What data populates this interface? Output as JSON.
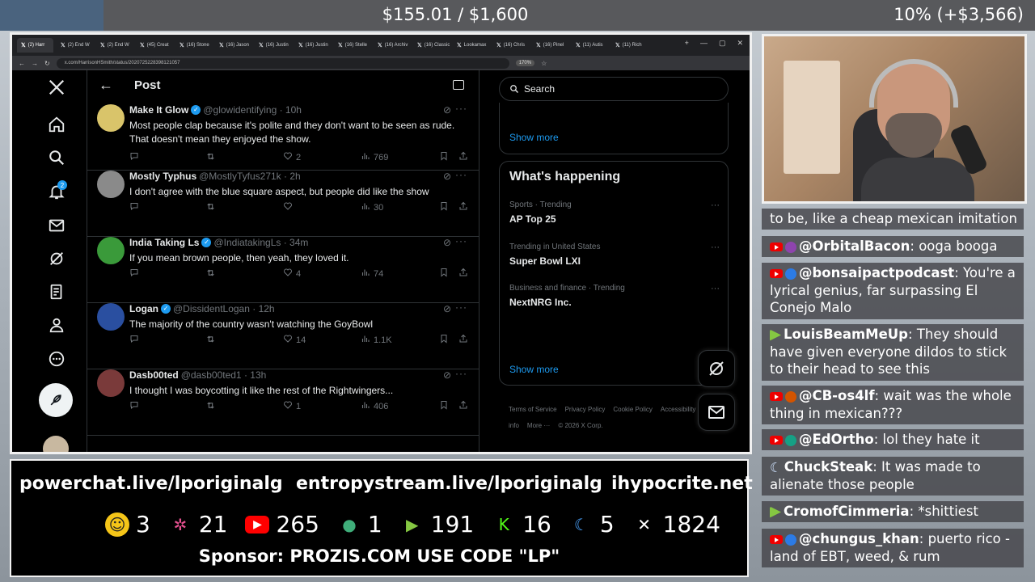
{
  "overlay": {
    "goal_text": "$155.01 / $1,600",
    "goal_percent_text": "10% (+$3,566)",
    "banner_links": [
      "powerchat.live/lporiginalg",
      "entropystream.live/lporiginalg",
      "ihypocrite.net"
    ],
    "counts": [
      {
        "platform": "robot-icon",
        "value": "3",
        "color": "#f5c518"
      },
      {
        "platform": "pinwheel-icon",
        "value": "21",
        "color": "#e4508f"
      },
      {
        "platform": "youtube-icon",
        "value": "265",
        "color": "#ff0000"
      },
      {
        "platform": "orb-icon",
        "value": "1",
        "color": "#3fae7a"
      },
      {
        "platform": "rumble-icon",
        "value": "191",
        "color": "#85c742"
      },
      {
        "platform": "kick-icon",
        "value": "16",
        "color": "#53fc18"
      },
      {
        "platform": "moon-icon",
        "value": "5",
        "color": "#4aa3ff"
      },
      {
        "platform": "x-icon",
        "value": "1824",
        "color": "#ffffff"
      }
    ],
    "sponsor": "Sponsor: PROZIS.COM USE CODE \"LP\""
  },
  "browser": {
    "tabs": [
      "(2) Harr",
      "(2) End W",
      "(2) End W",
      "(45) Creat",
      "(16) Stone",
      "(16) Jason",
      "(16) Justin",
      "(16) Justin",
      "(16) Stelle",
      "(16) Archiv",
      "(16) Classic",
      "Lookamax",
      "(16) Chris",
      "(16) Pinel",
      "(11) Autis",
      "(11) Rich"
    ],
    "url": "x.com/HarrisonHSmith/status/2020725228398121057",
    "zoom": "170%"
  },
  "x": {
    "header_title": "Post",
    "replies": [
      {
        "name": "Make It Glow",
        "verified": true,
        "handle": "@glowidentifying · 10h",
        "text": "Most people clap because it's polite and they don't want to be seen as rude. That doesn't mean they enjoyed the show.",
        "likes": "2",
        "views": "769",
        "avatar_color": "#d9c46a"
      },
      {
        "name": "Mostly Typhus",
        "verified": false,
        "handle": "@MostlyTyfus271k · 2h",
        "text": "I don't agree with the blue square aspect, but people did like the show",
        "likes": "",
        "views": "30",
        "avatar_color": "#8a8a8a"
      },
      {
        "name": "India Taking Ls",
        "verified": true,
        "handle": "@IndiatakingLs · 34m",
        "text": "If you mean brown people, then yeah, they loved it.",
        "likes": "4",
        "views": "74",
        "avatar_color": "#3a9a3a"
      },
      {
        "name": "Logan",
        "verified": true,
        "handle": "@DissidentLogan · 12h",
        "text": "The majority of the country wasn't watching the GoyBowl",
        "likes": "14",
        "views": "1.1K",
        "avatar_color": "#2a4fa0"
      },
      {
        "name": "Dasb00ted",
        "verified": false,
        "handle": "@dasb00ted1 · 13h",
        "text": "I thought I was boycotting it like the rest of the Rightwingers...",
        "likes": "1",
        "views": "406",
        "avatar_color": "#7a3a3a"
      }
    ],
    "search_placeholder": "Search",
    "top_show_more": "Show more",
    "happening": {
      "title": "What's happening",
      "trends": [
        {
          "meta": "Sports · Trending",
          "title": "AP Top 25"
        },
        {
          "meta": "Trending in United States",
          "title": "Super Bowl LXI"
        },
        {
          "meta": "Business and finance · Trending",
          "title": "NextNRG Inc."
        }
      ],
      "show_more": "Show more"
    },
    "footer": [
      "Terms of Service",
      "Privacy Policy",
      "Cookie Policy",
      "Accessibility",
      "Ads info",
      "More ···",
      "© 2026 X Corp."
    ]
  },
  "chat": [
    {
      "badges": [],
      "user": "",
      "text": "to be, like a cheap mexican imitation"
    },
    {
      "badges": [
        "youtube",
        "avatar"
      ],
      "user": "@OrbitalBacon",
      "text": "ooga booga"
    },
    {
      "badges": [
        "youtube",
        "avatar"
      ],
      "user": "@bonsaipactpodcast",
      "text": "You're a lyrical genius, far surpassing El Conejo Malo"
    },
    {
      "badges": [
        "rumble"
      ],
      "user": "LouisBeamMeUp",
      "text": "They should have given everyone dildos to stick to their head to see this"
    },
    {
      "badges": [
        "youtube",
        "avatar"
      ],
      "user": "@CB-os4lf",
      "text": "wait was the whole thing in mexican???"
    },
    {
      "badges": [
        "youtube",
        "avatar"
      ],
      "user": "@EdOrtho",
      "text": "lol they hate it"
    },
    {
      "badges": [
        "moon"
      ],
      "user": "ChuckSteak",
      "text": "It was made to alienate those people"
    },
    {
      "badges": [
        "rumble"
      ],
      "user": "CromofCimmeria",
      "text": "*shittiest"
    },
    {
      "badges": [
        "youtube",
        "avatar"
      ],
      "user": "@chungus_khan",
      "text": "puerto rico - land of EBT, weed, & rum"
    }
  ]
}
